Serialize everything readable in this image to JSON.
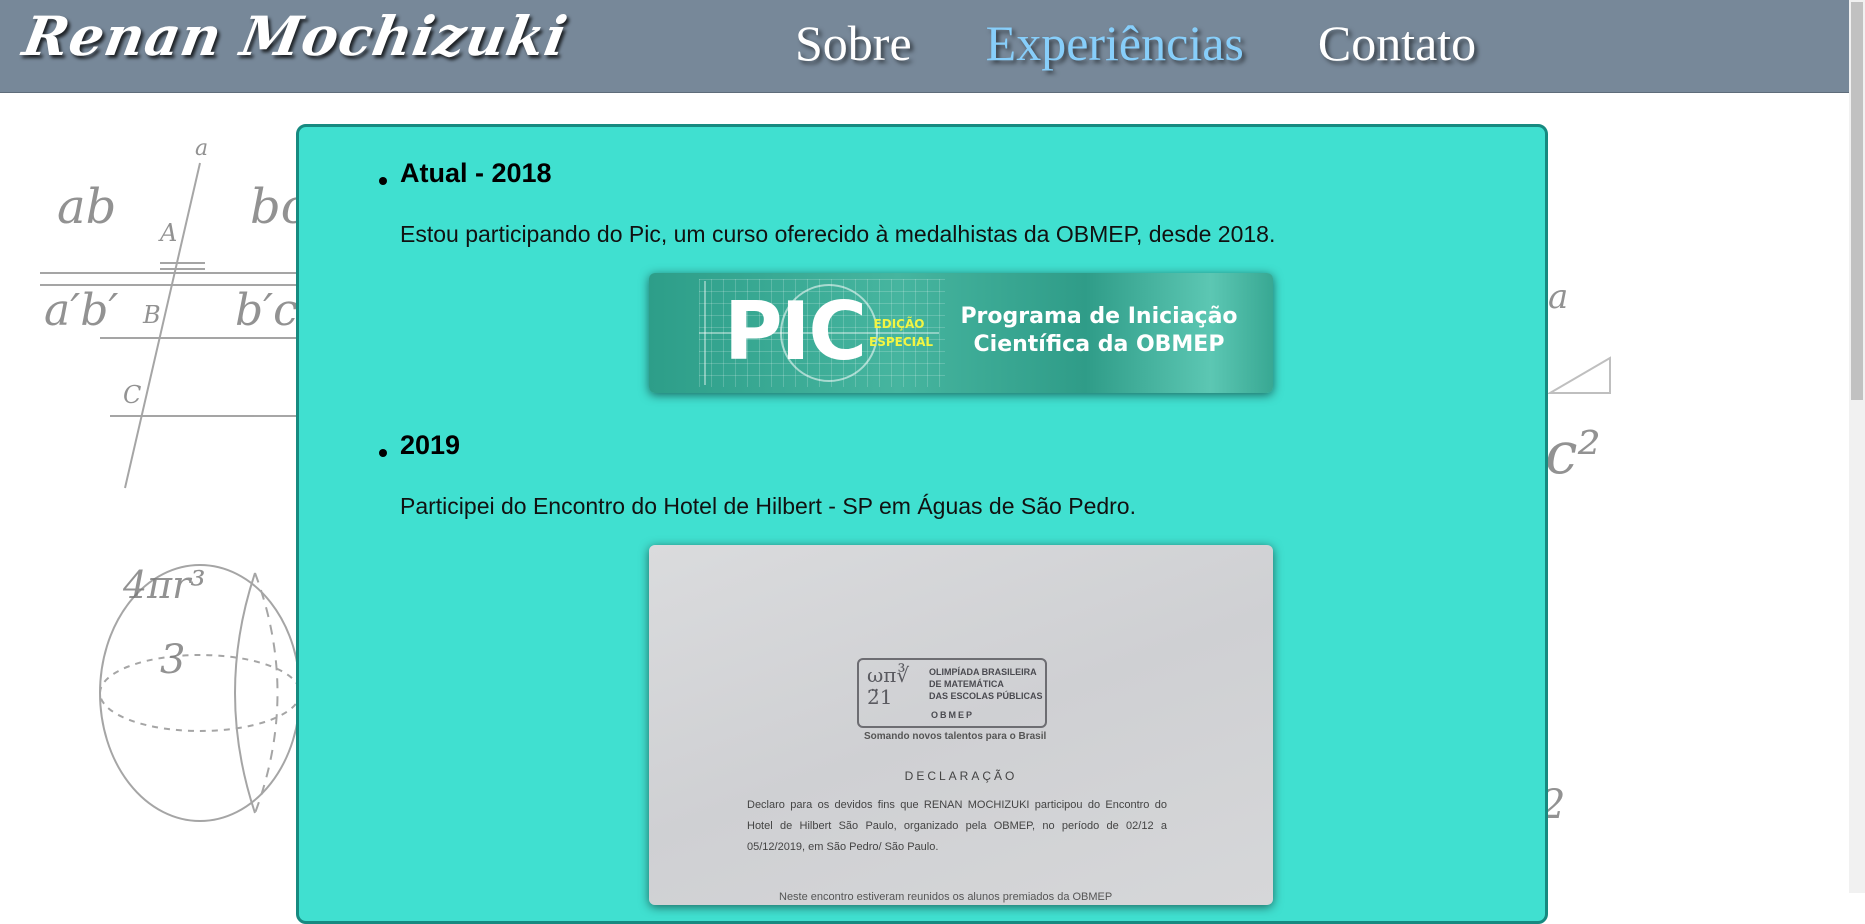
{
  "header": {
    "brand": "Renan Mochizuki",
    "nav": [
      {
        "label": "Sobre",
        "active": false
      },
      {
        "label": "Experiências",
        "active": true
      },
      {
        "label": "Contato",
        "active": false
      }
    ]
  },
  "experiences": [
    {
      "title": "Atual - 2018",
      "text": "Estou participando do Pic, um curso oferecido à medalhistas da OBMEP, desde 2018.",
      "image": {
        "logo_word": "PIC",
        "edition_line1": "EDIÇÃO",
        "edition_line2": "ESPECIAL",
        "title_line1": "Programa de Iniciação",
        "title_line2": "Científica da OBMEP"
      }
    },
    {
      "title": "2019",
      "text": "Participei do Encontro do Hotel de Hilbert - SP em Águas de São Pedro.",
      "document": {
        "stamp_line1": "OLIMPÍADA BRASILEIRA",
        "stamp_line2": "DE MATEMÁTICA",
        "stamp_line3": "DAS ESCOLAS PÚBLICAS",
        "stamp_sub": "OBMEP",
        "slogan": "Somando novos talentos para o Brasil",
        "heading": "DECLARAÇÃO",
        "body": "Declaro para os devidos fins que RENAN MOCHIZUKI participou do Encontro do Hotel de Hilbert São Paulo, organizado pela OBMEP, no período de 02/12 a 05/12/2019, em São Pedro/ São Paulo.",
        "more": "Neste encontro estiveram reunidos os alunos premiados da OBMEP"
      }
    }
  ],
  "colors": {
    "header_bg": "#778899",
    "nav_active": "#87cefa",
    "card_bg": "#40e0d0",
    "card_border": "#178a80"
  }
}
